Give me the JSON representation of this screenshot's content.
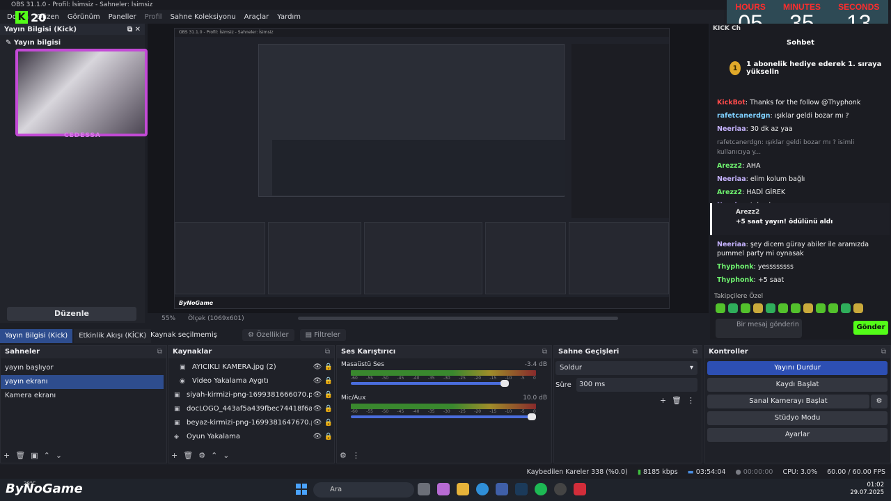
{
  "window": {
    "title": "OBS 31.1.0 - Profil: İsimsiz - Sahneler: İsimsiz"
  },
  "menu": [
    "Dosya",
    "Düzen",
    "Görünüm",
    "Paneller",
    "Profil",
    "Sahne Koleksiyonu",
    "Araçlar",
    "Yardım"
  ],
  "kick_badge": {
    "count": "20"
  },
  "left_dock": {
    "title": "Yayın Bilgisi (Kick)",
    "subtitle": "Yayın bilgisi",
    "edit_button": "Düzenle",
    "camera_name": "CEDESSA"
  },
  "timer": {
    "hours_label": "HOURS",
    "hours": "05",
    "minutes_label": "MINUTES",
    "minutes": "35",
    "seconds_label": "SECONDS",
    "seconds": "13"
  },
  "chat": {
    "dock_title": "KICK Ch",
    "title": "Sohbet",
    "pinned": "1 abonelik hediye ederek 1. sıraya yükselin",
    "pinned_rank": "1",
    "messages": [
      {
        "user": "KickBot",
        "text": "Thanks for the follow @Thyphonk",
        "color": "#ff4b4b"
      },
      {
        "user": "rafetcanerdgn",
        "text": "ışıklar geldi bozar mı ?",
        "color": "#7fd0ff"
      },
      {
        "user": "Neeriaa",
        "text": "30 dk az yaa",
        "color": "#c6b3ff"
      },
      {
        "reply": "rafetcanerdgn: ışıklar geldi bozar mı ? isimli kullanıcıya y..."
      },
      {
        "user": "Arezz2",
        "text": "AHA",
        "color": "#6ff26f"
      },
      {
        "user": "Neeriaa",
        "text": "elim kolum bağlı",
        "color": "#c6b3ff"
      },
      {
        "user": "Arezz2",
        "text": "HADİ GİREK",
        "color": "#6ff26f"
      },
      {
        "user": "Neeriaa",
        "text": "tel yok",
        "color": "#c6b3ff"
      }
    ],
    "redeem": {
      "user": "Arezz2",
      "reward": "+5 saat yayın! ödülünü aldı"
    },
    "messages2": [
      {
        "user": "Neeriaa",
        "text": "şey dicem güray abiler ile aramızda pummel party mi oynasak",
        "color": "#c6b3ff"
      },
      {
        "user": "Thyphonk",
        "text": "yessssssss",
        "color": "#6ff26f"
      },
      {
        "user": "Thyphonk",
        "text": "+5 saat",
        "color": "#6ff26f"
      }
    ],
    "followers_only": "Takipçilere Özel",
    "input_placeholder": "Bir mesaj gönderin",
    "send_button": "Gönder"
  },
  "preview": {
    "zoom": "55%",
    "scale": "Ölçek (1069x601)"
  },
  "tabs": [
    {
      "label": "Yayın Bilgisi (Kick)",
      "active": true
    },
    {
      "label": "Etkinlik Akışı (KİCK)",
      "active": false
    }
  ],
  "source_bar": {
    "label": "Kaynak seçilmemiş",
    "properties": "Özellikler",
    "filters": "Filtreler"
  },
  "scenes": {
    "title": "Sahneler",
    "items": [
      {
        "label": "yayın başlıyor",
        "selected": false
      },
      {
        "label": "yayın ekranı",
        "selected": true
      },
      {
        "label": "Kamera ekranı",
        "selected": false
      }
    ]
  },
  "sources": {
    "title": "Kaynaklar",
    "items": [
      {
        "icon": "image-icon",
        "label": "AYICIKLI KAMERA.jpg (2)",
        "indent": true
      },
      {
        "icon": "camera-icon",
        "label": "Video Yakalama Aygıtı",
        "indent": true
      },
      {
        "icon": "image-icon",
        "label": "siyah-kirmizi-png-1699381666070.png",
        "indent": false
      },
      {
        "icon": "image-icon",
        "label": "docLOGO_443af5a439fbec74418f6a5b0dd0",
        "indent": false
      },
      {
        "icon": "image-icon",
        "label": "beyaz-kirmizi-png-1699381647670.png",
        "indent": false
      },
      {
        "icon": "gamepad-icon",
        "label": "Oyun Yakalama",
        "indent": false
      }
    ]
  },
  "mixer": {
    "title": "Ses Karıştırıcı",
    "channels": [
      {
        "name": "Masaüstü Ses",
        "db": "-3.4 dB",
        "level": 0.85
      },
      {
        "name": "Mic/Aux",
        "db": "10.0 dB",
        "level": 1.0
      }
    ],
    "scale": [
      "-60",
      "-55",
      "-50",
      "-45",
      "-40",
      "-35",
      "-30",
      "-25",
      "-20",
      "-15",
      "-10",
      "-5",
      "0"
    ]
  },
  "transitions": {
    "title": "Sahne Geçişleri",
    "type": "Soldur",
    "duration_label": "Süre",
    "duration": "300 ms"
  },
  "controls": {
    "title": "Kontroller",
    "buttons": [
      {
        "label": "Yayını Durdur",
        "primary": true
      },
      {
        "label": "Kaydı Başlat"
      },
      {
        "label": "Sanal Kamerayı Başlat"
      },
      {
        "label": "Stüdyo Modu"
      },
      {
        "label": "Ayarlar"
      }
    ]
  },
  "status": {
    "dropped": "Kaybedilen Kareler 338 (%0.0)",
    "bitrate": "8185 kbps",
    "stream_time": "03:54:04",
    "rec_time": "00:00:00",
    "cpu": "CPU: 3.0%",
    "fps": "60.00 / 60.00 FPS"
  },
  "taskbar": {
    "logo": "ByNoGame",
    "temp": "28°C",
    "search": "Ara",
    "time": "01:02",
    "date": "29.07.2025"
  }
}
